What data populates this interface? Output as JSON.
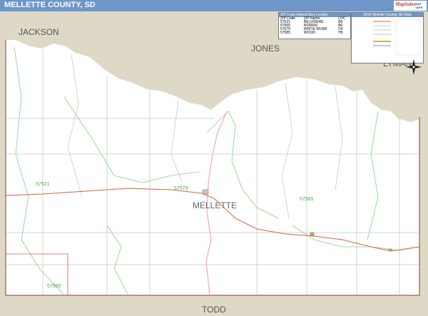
{
  "title": "MELLETTE COUNTY, SD",
  "logo_text": "MapSales",
  "logo_sub": "MAP TAPE",
  "zip_table": {
    "heading": "ZIP Code Index/Cities Locator",
    "columns": [
      "ZIP Code",
      "ZIP Name",
      "LOC"
    ],
    "rows": [
      [
        "57521",
        "BELVIDERE",
        "B4"
      ],
      [
        "57560",
        "NORRIS",
        "B6"
      ],
      [
        "57579",
        "WHITE RIVER",
        "D4"
      ],
      [
        "57585",
        "WOOD",
        "H5"
      ]
    ]
  },
  "legend_title": "2016 Mellette County, SD Map",
  "map": {
    "county_label": "MELLETTE",
    "neighbor_labels": [
      "JACKSON",
      "JONES",
      "LYMAN",
      "TODD"
    ],
    "zip_labels": [
      "57521",
      "57579",
      "57585",
      "57560"
    ],
    "colors": {
      "neighbor_fill": "#ddd9c6",
      "county_fill": "#ffffff",
      "zip_boundary": "#7fd47f",
      "highway": "#d9603b",
      "river": "#f2a4c4",
      "road": "#9a9a9a",
      "title_bar": "#6f96c9"
    }
  },
  "icons": [
    "compass-rose-icon",
    "logo-icon"
  ]
}
